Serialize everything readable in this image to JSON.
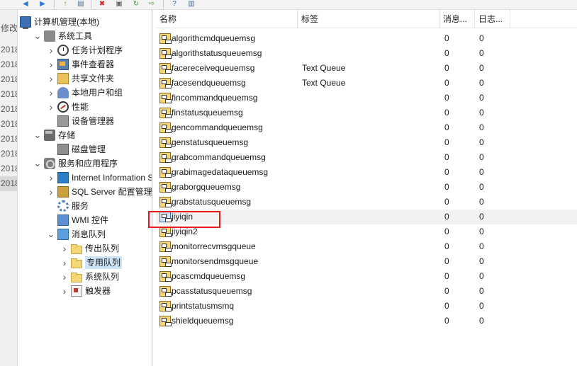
{
  "toolbar": {
    "buttons": [
      {
        "icon": "back-arrow-icon",
        "glyph": "◀",
        "color": "#2f7cd6"
      },
      {
        "icon": "forward-arrow-icon",
        "glyph": "▶",
        "color": "#2f7cd6"
      },
      {
        "icon": "up-folder-icon",
        "glyph": "↑",
        "color": "#5a9a3a"
      },
      {
        "icon": "show-hide-tree-icon",
        "glyph": "▤",
        "color": "#4a6ea0"
      },
      {
        "icon": "delete-icon",
        "glyph": "✖",
        "color": "#d22020"
      },
      {
        "icon": "properties-icon",
        "glyph": "▣",
        "color": "#666666"
      },
      {
        "icon": "refresh-icon",
        "glyph": "↻",
        "color": "#3a9a4a"
      },
      {
        "icon": "export-list-icon",
        "glyph": "⇨",
        "color": "#5a9a3a"
      },
      {
        "icon": "help-icon",
        "glyph": "?",
        "color": "#2f5cae"
      },
      {
        "icon": "show-action-pane-icon",
        "glyph": "▥",
        "color": "#4a6ea0"
      }
    ]
  },
  "leftmost": {
    "items": [
      "修改日",
      "2018",
      "2018",
      "2018",
      "2018",
      "2018",
      "2018",
      "2018",
      "2018",
      "2018",
      "2018"
    ]
  },
  "tree": {
    "nodes": [
      {
        "label": "计算机管理(本地)",
        "icon": "computer-icon",
        "cls": "i-computer",
        "depth": 0,
        "chev": "none"
      },
      {
        "label": "系统工具",
        "icon": "tools-icon",
        "cls": "i-tools",
        "depth": 1,
        "chev": "down"
      },
      {
        "label": "任务计划程序",
        "icon": "clock-icon",
        "cls": "i-clock",
        "depth": 2,
        "chev": "right"
      },
      {
        "label": "事件查看器",
        "icon": "event-viewer-icon",
        "cls": "i-event",
        "depth": 2,
        "chev": "right"
      },
      {
        "label": "共享文件夹",
        "icon": "shared-folder-icon",
        "cls": "i-share",
        "depth": 2,
        "chev": "right"
      },
      {
        "label": "本地用户和组",
        "icon": "users-icon",
        "cls": "i-users",
        "depth": 2,
        "chev": "right"
      },
      {
        "label": "性能",
        "icon": "performance-icon",
        "cls": "i-perf",
        "depth": 2,
        "chev": "right"
      },
      {
        "label": "设备管理器",
        "icon": "device-manager-icon",
        "cls": "i-device",
        "depth": 2,
        "chev": "none"
      },
      {
        "label": "存储",
        "icon": "storage-icon",
        "cls": "i-storage",
        "depth": 1,
        "chev": "down"
      },
      {
        "label": "磁盘管理",
        "icon": "disk-icon",
        "cls": "i-disk",
        "depth": 2,
        "chev": "none"
      },
      {
        "label": "服务和应用程序",
        "icon": "services-apps-icon",
        "cls": "i-services",
        "depth": 1,
        "chev": "down"
      },
      {
        "label": "Internet Information Services (IIS)管理器",
        "icon": "iis-icon",
        "cls": "i-iis",
        "depth": 2,
        "chev": "right"
      },
      {
        "label": "SQL Server 配置管理器",
        "icon": "sql-server-icon",
        "cls": "i-sql",
        "depth": 2,
        "chev": "right"
      },
      {
        "label": "服务",
        "icon": "services-icon",
        "cls": "i-gear",
        "depth": 2,
        "chev": "none"
      },
      {
        "label": "WMI 控件",
        "icon": "wmi-icon",
        "cls": "i-wmi",
        "depth": 2,
        "chev": "none"
      },
      {
        "label": "消息队列",
        "icon": "message-queue-icon",
        "cls": "i-mq",
        "depth": 2,
        "chev": "down"
      },
      {
        "label": "传出队列",
        "icon": "folder-icon",
        "cls": "i-folder",
        "depth": 3,
        "chev": "right"
      },
      {
        "label": "专用队列",
        "icon": "folder-icon",
        "cls": "i-folder",
        "depth": 3,
        "chev": "right",
        "selected": true
      },
      {
        "label": "系统队列",
        "icon": "folder-icon",
        "cls": "i-folder",
        "depth": 3,
        "chev": "right"
      },
      {
        "label": "触发器",
        "icon": "trigger-icon",
        "cls": "i-trigger",
        "depth": 3,
        "chev": "right"
      }
    ]
  },
  "list": {
    "columns": [
      "名称",
      "标签",
      "消息...",
      "日志..."
    ],
    "rows": [
      {
        "name": "algorithcmdqueuemsg",
        "label": "",
        "messages": "0",
        "journal": "0"
      },
      {
        "name": "algorithstatusqueuemsg",
        "label": "",
        "messages": "0",
        "journal": "0"
      },
      {
        "name": "facereceivequeuemsg",
        "label": "Text Queue",
        "messages": "0",
        "journal": "0"
      },
      {
        "name": "facesendqueuemsg",
        "label": "Text Queue",
        "messages": "0",
        "journal": "0"
      },
      {
        "name": "fincommandqueuemsg",
        "label": "",
        "messages": "0",
        "journal": "0"
      },
      {
        "name": "finstatusqueuemsg",
        "label": "",
        "messages": "0",
        "journal": "0"
      },
      {
        "name": "gencommandqueuemsg",
        "label": "",
        "messages": "0",
        "journal": "0"
      },
      {
        "name": "genstatusqueuemsg",
        "label": "",
        "messages": "0",
        "journal": "0"
      },
      {
        "name": "grabcommandqueuemsg",
        "label": "",
        "messages": "0",
        "journal": "0"
      },
      {
        "name": "grabimagedataqueuemsg",
        "label": "",
        "messages": "0",
        "journal": "0"
      },
      {
        "name": "graborgqueuemsg",
        "label": "",
        "messages": "0",
        "journal": "0"
      },
      {
        "name": "grabstatusqueuemsg",
        "label": "",
        "messages": "0",
        "journal": "0"
      },
      {
        "name": "jiyiqin",
        "label": "",
        "messages": "0",
        "journal": "0",
        "highlight": true
      },
      {
        "name": "jiyiqin2",
        "label": "",
        "messages": "0",
        "journal": "0"
      },
      {
        "name": "monitorrecvmsgqueue",
        "label": "",
        "messages": "0",
        "journal": "0"
      },
      {
        "name": "monitorsendmsgqueue",
        "label": "",
        "messages": "0",
        "journal": "0"
      },
      {
        "name": "pcascmdqueuemsg",
        "label": "",
        "messages": "0",
        "journal": "0"
      },
      {
        "name": "pcasstatusqueuemsg",
        "label": "",
        "messages": "0",
        "journal": "0"
      },
      {
        "name": "printstatusmsmq",
        "label": "",
        "messages": "0",
        "journal": "0"
      },
      {
        "name": "shieldqueuemsg",
        "label": "",
        "messages": "0",
        "journal": "0"
      }
    ]
  },
  "colors": {
    "selection": "#cce4f7",
    "row_highlight": "#f2f2f2",
    "annotation_box": "#e21b1b"
  }
}
